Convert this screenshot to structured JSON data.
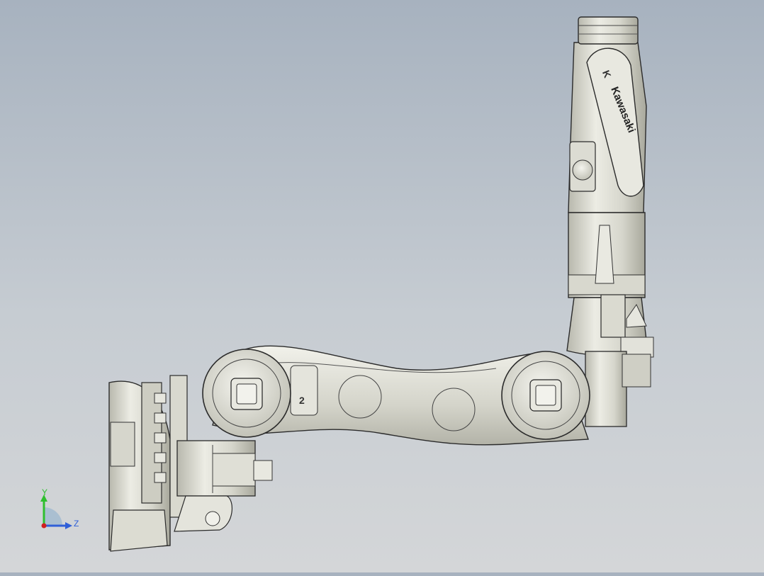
{
  "viewport": {
    "brand_logo_text": "Kawasaki",
    "brand_emblem_text": "K",
    "axis_mark_text": "2",
    "colors": {
      "background_top": "#a7b2bf",
      "background_bottom": "#d4d6d8",
      "metal_light": "#ecece4",
      "metal_mid": "#d2d2c8",
      "metal_dark": "#a9a99e",
      "edge": "#2b2b2b"
    }
  },
  "triad": {
    "y_label": "Y",
    "z_label": "Z",
    "y_color": "#2fbf2f",
    "z_color": "#2f5fd8",
    "x_color": "#d02020"
  }
}
